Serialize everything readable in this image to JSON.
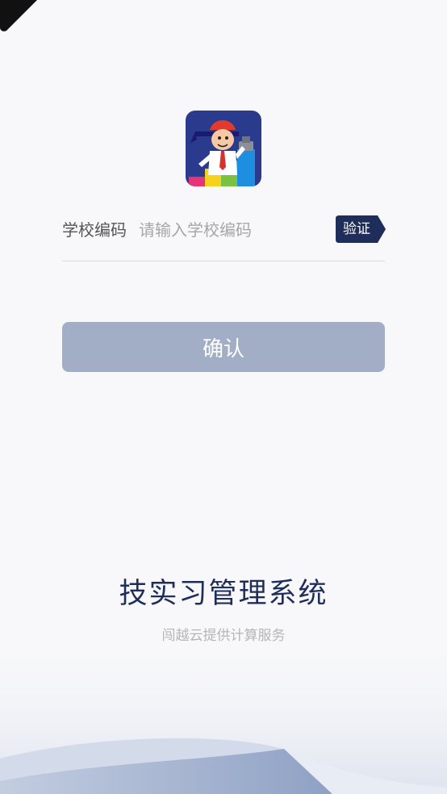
{
  "login": {
    "field_label": "学校编码",
    "field_placeholder": "请输入学校编码",
    "field_value": "",
    "verify_label": "验证",
    "confirm_label": "确认"
  },
  "footer": {
    "title": "技实习管理系统",
    "provider": "闯越云提供计算服务"
  },
  "colors": {
    "brand": "#1f2d5a",
    "button_disabled": "#a2adc6",
    "background": "#f8f8fa"
  }
}
